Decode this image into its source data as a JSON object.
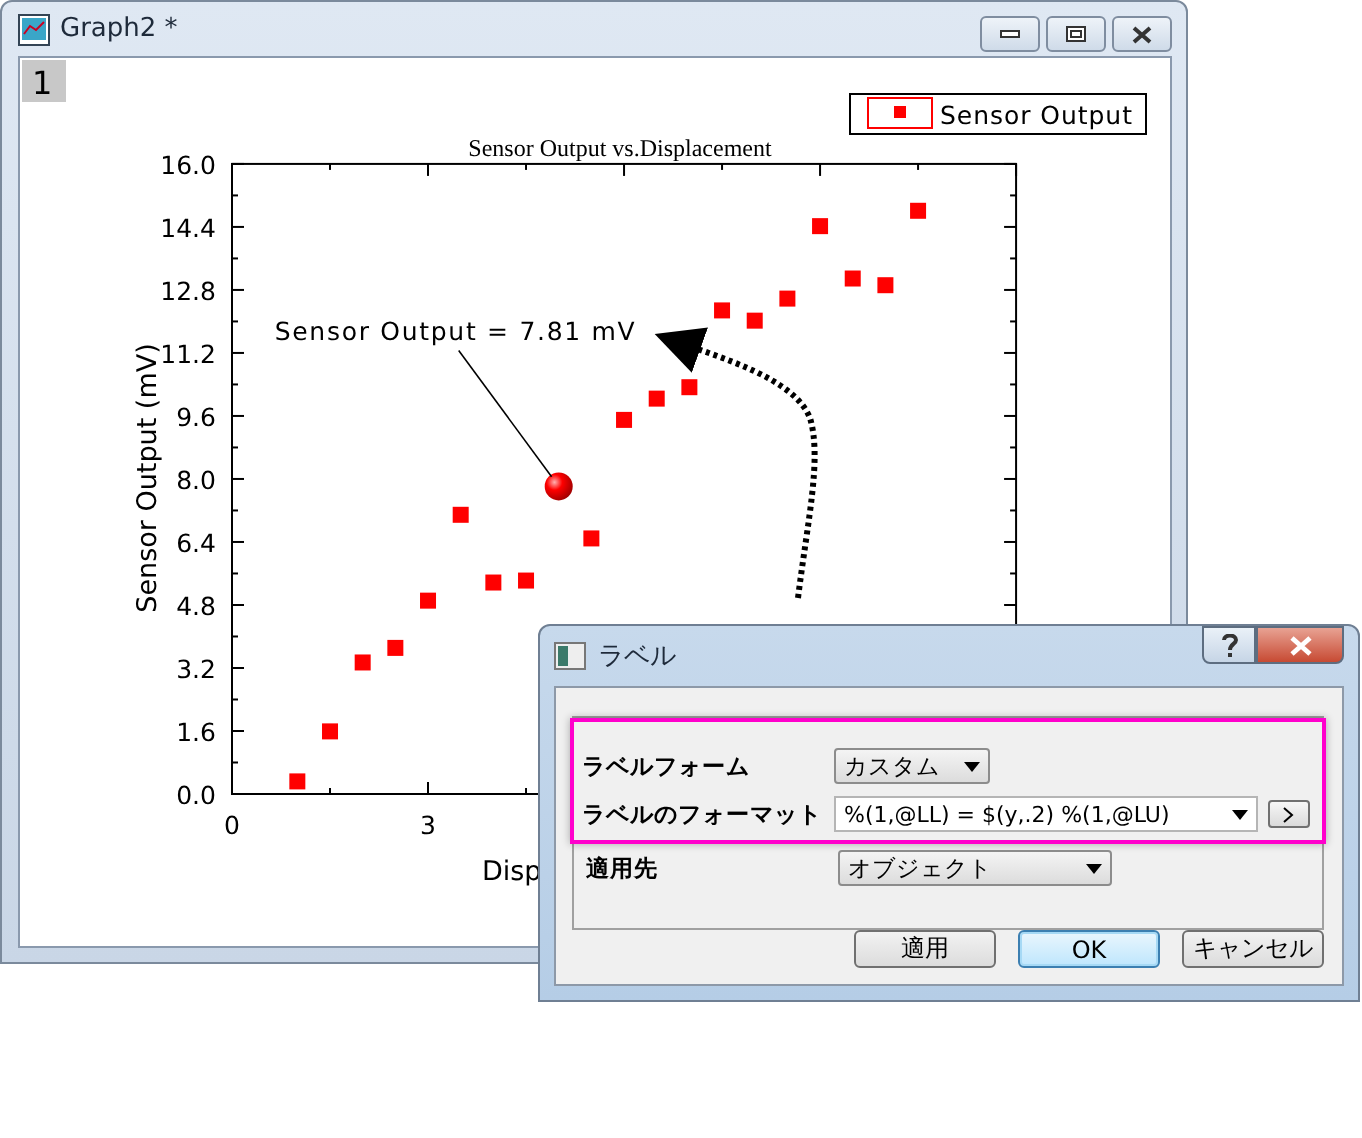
{
  "graph_window": {
    "title": "Graph2 *",
    "layer": "1",
    "chart_data": {
      "type": "scatter",
      "title": "Sensor Output vs.Displacement",
      "xlabel": "Disp",
      "ylabel": "Sensor Output (mV)",
      "x": [
        1,
        1.5,
        2,
        2.5,
        3,
        3.5,
        4,
        4.5,
        5,
        5.5,
        6,
        6.5,
        7,
        7.5,
        8,
        8.5,
        9,
        9.5,
        10,
        10.5
      ],
      "series": [
        {
          "name": "Sensor Output",
          "color": "#ff0000",
          "values": [
            0.32,
            1.59,
            3.34,
            3.71,
            4.91,
            7.09,
            5.37,
            5.42,
            7.81,
            6.49,
            9.5,
            10.04,
            10.33,
            12.28,
            12.02,
            12.58,
            14.42,
            13.09,
            12.92,
            14.81
          ]
        }
      ],
      "xlim": [
        0,
        12
      ],
      "ylim": [
        0,
        16
      ],
      "xticks": [
        0,
        3
      ],
      "yticks": [
        {
          "value": 0,
          "label": "0.0"
        },
        {
          "value": 1.6,
          "label": "1.6"
        },
        {
          "value": 3.2,
          "label": "3.2"
        },
        {
          "value": 4.8,
          "label": "4.8"
        },
        {
          "value": 6.4,
          "label": "6.4"
        },
        {
          "value": 8,
          "label": "8.0"
        },
        {
          "value": 9.6,
          "label": "9.6"
        },
        {
          "value": 11.2,
          "label": "11.2"
        },
        {
          "value": 12.8,
          "label": "12.8"
        },
        {
          "value": 14.4,
          "label": "14.4"
        },
        {
          "value": 16,
          "label": "16.0"
        }
      ],
      "annotations": [
        {
          "text": "Sensor Output = 7.81 mV",
          "x": 5,
          "y": 7.81
        }
      ]
    }
  },
  "dialog": {
    "title": "ラベル",
    "fields": [
      {
        "label": "ラベルフォーム",
        "value": "カスタム",
        "kind": "dropdown",
        "highlighted": true
      },
      {
        "label": "ラベルのフォーマット",
        "value": "%(1,@LL) = $(y,.2) %(1,@LU)",
        "kind": "combo",
        "highlighted": true
      },
      {
        "label": "適用先",
        "value": "オブジェクト",
        "kind": "dropdown",
        "highlighted": false
      }
    ],
    "buttons": [
      {
        "label": "適用",
        "selected": false
      },
      {
        "label": "OK",
        "selected": true
      },
      {
        "label": "キャンセル",
        "selected": false
      }
    ]
  }
}
